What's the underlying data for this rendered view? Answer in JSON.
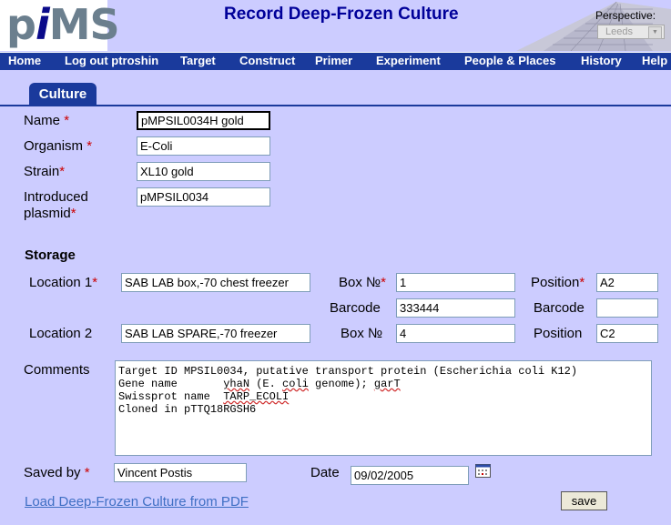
{
  "header": {
    "logo": {
      "p": "p",
      "i": "i",
      "ms": "MS"
    },
    "title": "Record Deep-Frozen Culture",
    "perspective_label": "Perspective:",
    "perspective_value": "Leeds"
  },
  "nav": [
    "Home",
    "Log out ptroshin",
    "Target",
    "Construct",
    "Primer",
    "Experiment",
    "People & Places",
    "History",
    "Help"
  ],
  "tab": "Culture",
  "form": {
    "name_label": "Name",
    "name_value": "pMPSIL0034H gold",
    "organism_label": "Organism",
    "organism_value": "E-Coli",
    "strain_label": "Strain",
    "strain_value": "XL10 gold",
    "plasmid_label_1": "Introduced",
    "plasmid_label_2": "plasmid",
    "plasmid_value": "pMPSIL0034",
    "required_mark": "*"
  },
  "storage": {
    "title": "Storage",
    "location1_label": "Location 1",
    "location1_value": "SAB LAB box,-70 chest freezer",
    "box1_label": "Box №",
    "box1_value": "1",
    "position1_label": "Position",
    "position1_value": "A2",
    "barcode_label_left": "Barcode",
    "barcode_value_left": "333444",
    "barcode_label_right": "Barcode",
    "barcode_value_right": "",
    "location2_label": "Location 2",
    "location2_value": "SAB LAB SPARE,-70 freezer",
    "box2_label": "Box №",
    "box2_value": "4",
    "position2_label": "Position",
    "position2_value": "C2"
  },
  "comments": {
    "label": "Comments",
    "line1": "Target ID MPSIL0034, putative transport protein (Escherichia coli K12)",
    "line2_a": "Gene name       ",
    "line2_b": "yhaN",
    "line2_c": " (E. ",
    "line2_d": "coli",
    "line2_e": " genome); ",
    "line2_f": "garT",
    "line3_a": "Swissprot name  ",
    "line3_b": "TARP_ECOLI",
    "line4": "Cloned in pTTQ18RGSH6"
  },
  "footer": {
    "saved_by_label": "Saved by",
    "saved_by_value": "Vincent Postis",
    "date_label": "Date",
    "date_value": "09/02/2005",
    "pdf_link": "Load Deep-Frozen Culture from PDF",
    "save_button": "save"
  },
  "colors": {
    "background": "#ccccff",
    "nav": "#1a3a9c",
    "title": "#000099",
    "required": "#cc0000",
    "link": "#3f6fc4"
  }
}
